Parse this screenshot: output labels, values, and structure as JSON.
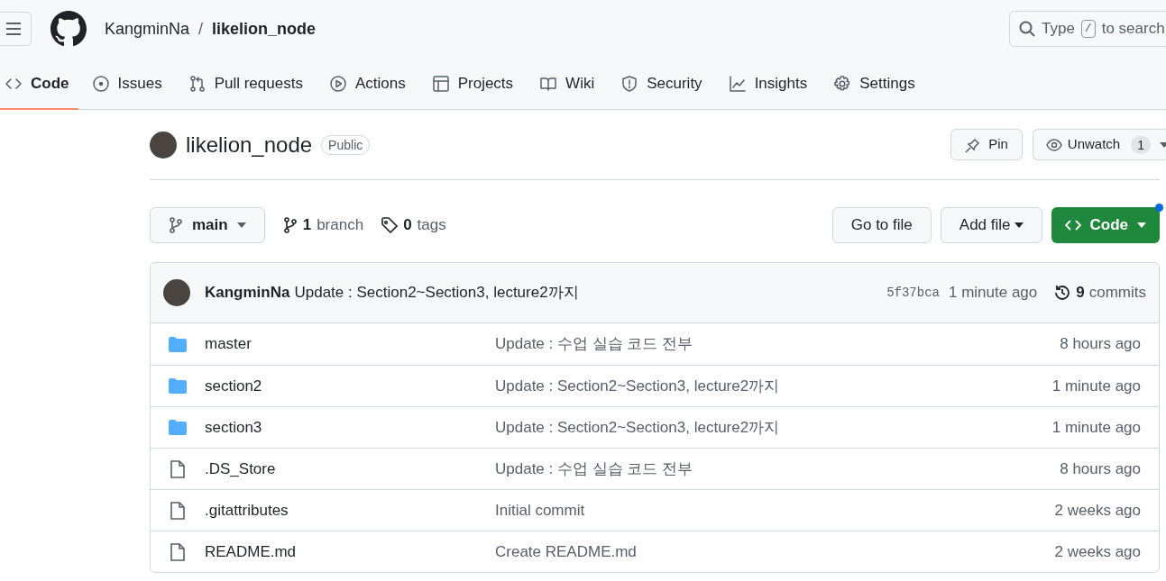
{
  "header": {
    "owner": "KangminNa",
    "separator": "/",
    "repo": "likelion_node",
    "search": {
      "placeholder_before": "Type",
      "key": "/",
      "placeholder_after": "to search"
    }
  },
  "tabs": [
    {
      "label": "Code",
      "kind": "code",
      "selected": true
    },
    {
      "label": "Issues",
      "kind": "issue",
      "selected": false
    },
    {
      "label": "Pull requests",
      "kind": "pr",
      "selected": false
    },
    {
      "label": "Actions",
      "kind": "play",
      "selected": false
    },
    {
      "label": "Projects",
      "kind": "table",
      "selected": false
    },
    {
      "label": "Wiki",
      "kind": "book",
      "selected": false
    },
    {
      "label": "Security",
      "kind": "shield",
      "selected": false
    },
    {
      "label": "Insights",
      "kind": "graph",
      "selected": false
    },
    {
      "label": "Settings",
      "kind": "gear",
      "selected": false
    }
  ],
  "repo": {
    "name": "likelion_node",
    "visibility": "Public",
    "pin": "Pin",
    "watch": "Unwatch",
    "watch_count": "1"
  },
  "toolbar": {
    "branch": "main",
    "branches_count": "1",
    "branches_label": "branch",
    "tags_count": "0",
    "tags_label": "tags",
    "go_to_file": "Go to file",
    "add_file": "Add file",
    "code": "Code"
  },
  "latest_commit": {
    "author": "KangminNa",
    "message": "Update : Section2~Section3, lecture2까지",
    "sha": "5f37bca",
    "time": "1 minute ago",
    "commits_count": "9",
    "commits_label": "commits"
  },
  "files": [
    {
      "kind": "folder",
      "name": "master",
      "message": "Update : 수업 실습 코드 전부",
      "time": "8 hours ago"
    },
    {
      "kind": "folder",
      "name": "section2",
      "message": "Update : Section2~Section3, lecture2까지",
      "time": "1 minute ago"
    },
    {
      "kind": "folder",
      "name": "section3",
      "message": "Update : Section2~Section3, lecture2까지",
      "time": "1 minute ago"
    },
    {
      "kind": "file",
      "name": ".DS_Store",
      "message": "Update : 수업 실습 코드 전부",
      "time": "8 hours ago"
    },
    {
      "kind": "file",
      "name": ".gitattributes",
      "message": "Initial commit",
      "time": "2 weeks ago"
    },
    {
      "kind": "file",
      "name": "README.md",
      "message": "Create README.md",
      "time": "2 weeks ago"
    }
  ]
}
